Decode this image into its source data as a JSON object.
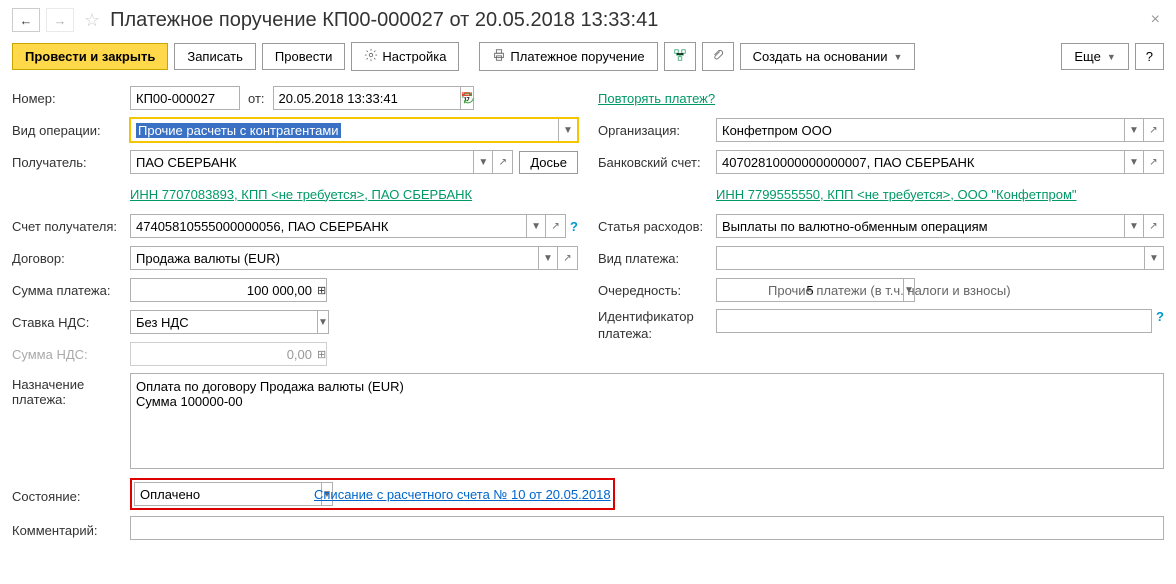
{
  "header": {
    "title": "Платежное поручение КП00-000027 от 20.05.2018 13:33:41"
  },
  "toolbar": {
    "submit_close": "Провести и закрыть",
    "save": "Записать",
    "submit": "Провести",
    "settings": "Настройка",
    "payment_order": "Платежное поручение",
    "create_based": "Создать на основании",
    "more": "Еще"
  },
  "left": {
    "number_lbl": "Номер:",
    "number": "КП00-000027",
    "from_lbl": "от:",
    "date": "20.05.2018 13:33:41",
    "op_type_lbl": "Вид операции:",
    "op_type": "Прочие расчеты с контрагентами",
    "recipient_lbl": "Получатель:",
    "recipient": "ПАО СБЕРБАНК",
    "dossier": "Досье",
    "recipient_link": "ИНН 7707083893, КПП <не требуется>, ПАО СБЕРБАНК",
    "recipient_acc_lbl": "Счет получателя:",
    "recipient_acc": "47405810555000000056, ПАО СБЕРБАНК",
    "contract_lbl": "Договор:",
    "contract": "Продажа валюты (EUR)",
    "amount_lbl": "Сумма платежа:",
    "amount": "100 000,00",
    "vat_rate_lbl": "Ставка НДС:",
    "vat_rate": "Без НДС",
    "vat_sum_lbl": "Сумма НДС:",
    "vat_sum": "0,00"
  },
  "right": {
    "repeat_link": "Повторять платеж?",
    "org_lbl": "Организация:",
    "org": "Конфетпром ООО",
    "bank_acc_lbl": "Банковский счет:",
    "bank_acc": "40702810000000000007, ПАО СБЕРБАНК",
    "org_link": "ИНН 7799555550, КПП <не требуется>, ООО \"Конфетпром\"",
    "expense_lbl": "Статья расходов:",
    "expense": "Выплаты по валютно-обменным операциям",
    "pay_type_lbl": "Вид платежа:",
    "pay_type": "",
    "priority_lbl": "Очередность:",
    "priority": "5",
    "priority_hint": "Прочие платежи (в т.ч. налоги и взносы)",
    "pay_id_lbl": "Идентификатор платежа:",
    "pay_id": ""
  },
  "bottom": {
    "purpose_lbl": "Назначение платежа:",
    "purpose": "Оплата по договору Продажа валюты (EUR)\nСумма 100000-00",
    "status_lbl": "Состояние:",
    "status": "Оплачено",
    "status_link": "Списание с расчетного счета № 10 от 20.05.2018",
    "comment_lbl": "Комментарий:",
    "comment": ""
  }
}
